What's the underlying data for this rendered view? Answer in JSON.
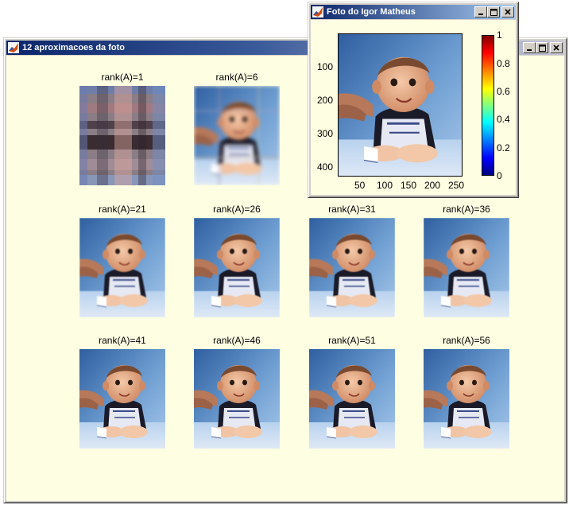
{
  "main_window": {
    "title": "12 aproximacoes da foto",
    "buttons": [
      "minimize",
      "maximize",
      "close"
    ],
    "approximations": [
      {
        "label": "rank(A)=1"
      },
      {
        "label": "rank(A)=6"
      },
      {
        "label": "rank(A)=21"
      },
      {
        "label": "rank(A)=26"
      },
      {
        "label": "rank(A)=31"
      },
      {
        "label": "rank(A)=36"
      },
      {
        "label": "rank(A)=41"
      },
      {
        "label": "rank(A)=46"
      },
      {
        "label": "rank(A)=51"
      },
      {
        "label": "rank(A)=56"
      }
    ]
  },
  "photo_window": {
    "title": "Foto do Igor Matheus",
    "buttons": [
      "minimize",
      "maximize",
      "close"
    ],
    "y_ticks": [
      "100",
      "200",
      "300",
      "400"
    ],
    "x_ticks": [
      "50",
      "100",
      "150",
      "200",
      "250"
    ],
    "colorbar_ticks": [
      "1",
      "0.8",
      "0.6",
      "0.4",
      "0.2",
      "0"
    ],
    "colormap": "jet"
  },
  "colors": {
    "client_background": "#fefee3",
    "title_active": "#0a246a",
    "chrome": "#d4d0c8"
  }
}
